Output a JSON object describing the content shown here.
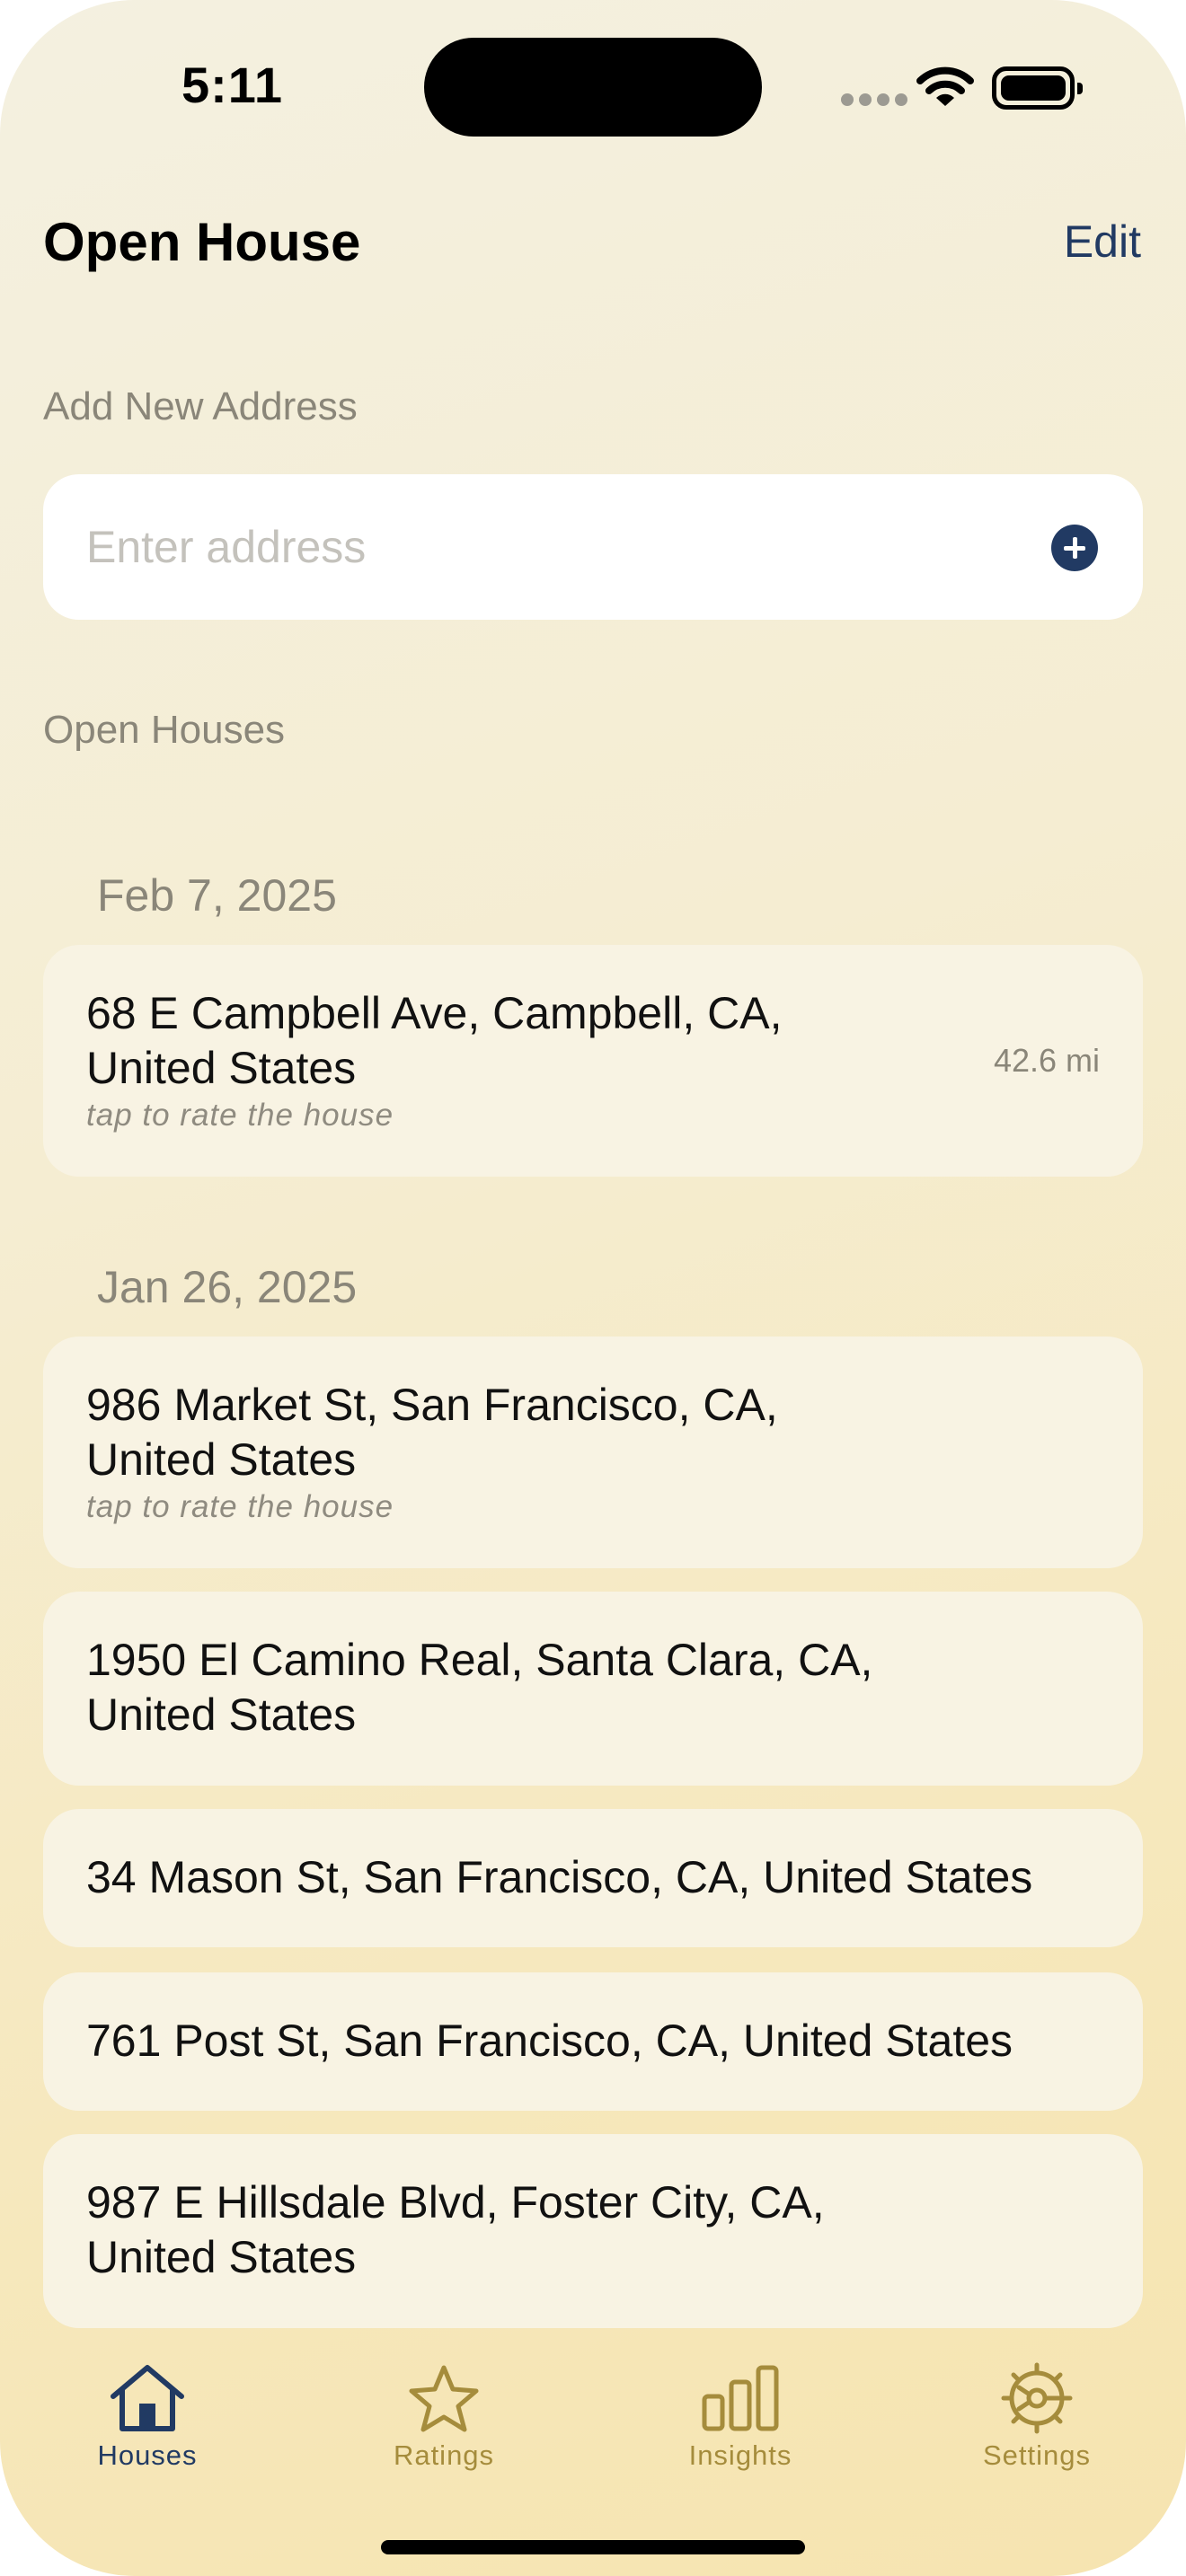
{
  "status_bar": {
    "time": "5:11"
  },
  "header": {
    "title": "Open House",
    "edit_label": "Edit"
  },
  "add_address": {
    "section_label": "Add New Address",
    "placeholder": "Enter address",
    "value": ""
  },
  "open_houses": {
    "section_label": "Open Houses",
    "groups": [
      {
        "date": "Feb 7, 2025",
        "items": [
          {
            "line1": "68 E Campbell Ave, Campbell, CA,",
            "line2": "United States",
            "hint": "tap to rate the house",
            "distance": "42.6 mi"
          }
        ]
      },
      {
        "date": "Jan 26, 2025",
        "items": [
          {
            "line1": "986 Market St, San Francisco, CA,",
            "line2": "United States",
            "hint": "tap to rate the house"
          },
          {
            "line1": "1950 El Camino Real, Santa Clara, CA,",
            "line2": "United States"
          },
          {
            "line1": "34 Mason St, San Francisco, CA, United States"
          },
          {
            "line1": "761 Post St, San Francisco, CA, United States"
          },
          {
            "line1": "987 E Hillsdale Blvd, Foster City, CA,",
            "line2": "United States"
          }
        ]
      }
    ]
  },
  "tab_bar": {
    "tabs": [
      {
        "label": "Houses",
        "icon": "house-icon",
        "active": true
      },
      {
        "label": "Ratings",
        "icon": "star-icon",
        "active": false
      },
      {
        "label": "Insights",
        "icon": "bar-chart-icon",
        "active": false
      },
      {
        "label": "Settings",
        "icon": "gear-icon",
        "active": false
      }
    ]
  },
  "colors": {
    "accent": "#213a63",
    "tab_inactive": "#a58c3c",
    "card_background": "#f8f3e3",
    "secondary_text": "#8a8679"
  }
}
